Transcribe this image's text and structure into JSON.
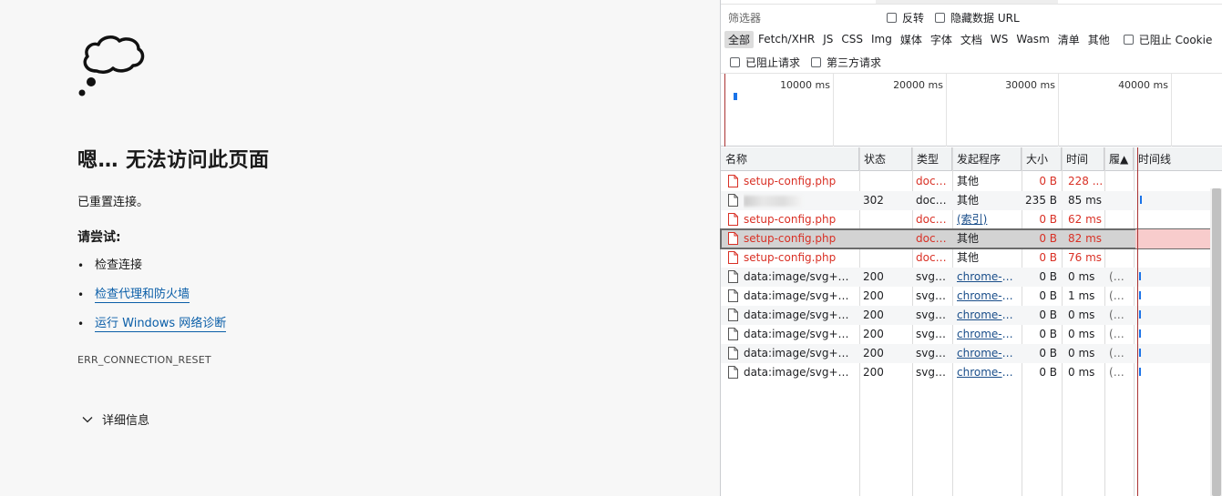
{
  "error_page": {
    "title": "嗯… 无法访问此页面",
    "description": "已重置连接。",
    "try_heading": "请尝试:",
    "suggestions": [
      {
        "text": "检查连接",
        "link": false
      },
      {
        "text": "检查代理和防火墙",
        "link": true
      },
      {
        "text": "运行 Windows 网络诊断",
        "link": true
      }
    ],
    "error_code": "ERR_CONNECTION_RESET",
    "details_label": "详细信息"
  },
  "devtools": {
    "filter_placeholder": "筛选器",
    "invert_label": "反转",
    "hide_data_url_label": "隐藏数据 URL",
    "type_filters": [
      "全部",
      "Fetch/XHR",
      "JS",
      "CSS",
      "Img",
      "媒体",
      "字体",
      "文档",
      "WS",
      "Wasm",
      "清单",
      "其他"
    ],
    "blocked_cookies_label": "已阻止 Cookie",
    "blocked_requests_label": "已阻止请求",
    "third_party_label": "第三方请求",
    "overview_ticks": [
      "10000 ms",
      "20000 ms",
      "30000 ms",
      "40000 ms"
    ],
    "columns": {
      "name": "名称",
      "status": "状态",
      "type": "类型",
      "initiator": "发起程序",
      "size": "大小",
      "time": "时间",
      "priority": "履▲",
      "waterfall": "时间线"
    },
    "requests": [
      {
        "name": "setup-config.php",
        "status": "",
        "type": "docu...",
        "initiator": "其他",
        "initiator_link": false,
        "size": "0 B",
        "time": "228 ...",
        "priority": "",
        "error": true
      },
      {
        "name": "",
        "status": "302",
        "type": "docu...",
        "initiator": "其他",
        "initiator_link": false,
        "size": "235 B",
        "time": "85 ms",
        "priority": "",
        "error": false
      },
      {
        "name": "setup-config.php",
        "status": "",
        "type": "docu...",
        "initiator": "(索引)",
        "initiator_link": true,
        "size": "0 B",
        "time": "62 ms",
        "priority": "",
        "error": true
      },
      {
        "name": "setup-config.php",
        "status": "",
        "type": "docu...",
        "initiator": "其他",
        "initiator_link": false,
        "size": "0 B",
        "time": "82 ms",
        "priority": "",
        "error": true,
        "selected": true
      },
      {
        "name": "setup-config.php",
        "status": "",
        "type": "docu...",
        "initiator": "其他",
        "initiator_link": false,
        "size": "0 B",
        "time": "76 ms",
        "priority": "",
        "error": true
      },
      {
        "name": "data:image/svg+xml;...",
        "status": "200",
        "type": "svg+...",
        "initiator": "chrome-er...",
        "initiator_link": true,
        "size": "0 B",
        "time": "0 ms",
        "priority": "(m...",
        "error": false
      },
      {
        "name": "data:image/svg+xml;...",
        "status": "200",
        "type": "svg+...",
        "initiator": "chrome-er...",
        "initiator_link": true,
        "size": "0 B",
        "time": "1 ms",
        "priority": "(m...",
        "error": false
      },
      {
        "name": "data:image/svg+xml;...",
        "status": "200",
        "type": "svg+...",
        "initiator": "chrome-er...",
        "initiator_link": true,
        "size": "0 B",
        "time": "0 ms",
        "priority": "(m...",
        "error": false
      },
      {
        "name": "data:image/svg+xml;...",
        "status": "200",
        "type": "svg+...",
        "initiator": "chrome-er...",
        "initiator_link": true,
        "size": "0 B",
        "time": "0 ms",
        "priority": "(m...",
        "error": false
      },
      {
        "name": "data:image/svg+xml;...",
        "status": "200",
        "type": "svg+...",
        "initiator": "chrome-er...",
        "initiator_link": true,
        "size": "0 B",
        "time": "0 ms",
        "priority": "(m...",
        "error": false
      },
      {
        "name": "data:image/svg+xml;...",
        "status": "200",
        "type": "svg+...",
        "initiator": "chrome-er...",
        "initiator_link": true,
        "size": "0 B",
        "time": "0 ms",
        "priority": "(m...",
        "error": false
      }
    ]
  }
}
